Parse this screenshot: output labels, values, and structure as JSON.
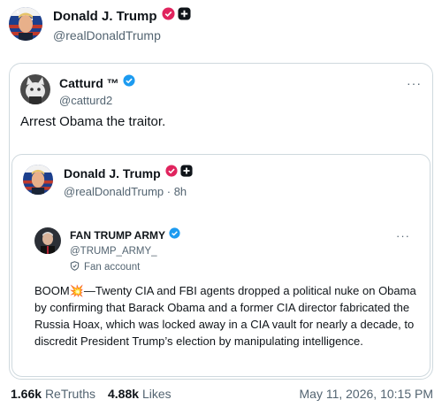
{
  "top_post": {
    "author_name": "Donald J. Trump",
    "author_handle": "@realDonaldTrump"
  },
  "quoted_post": {
    "author_name": "Catturd ™",
    "author_handle": "@catturd2",
    "text": "Arrest Obama the traitor.",
    "more_label": "···"
  },
  "inner_post": {
    "author_name": "Donald J. Trump",
    "author_handle": "@realDonaldTrump · 8h"
  },
  "fan_post": {
    "author_name": "FAN TRUMP ARMY",
    "author_handle": "@TRUMP_ARMY_",
    "account_label": "Fan account",
    "more_label": "···",
    "body_prefix": "BOOM",
    "body_emoji": "💥",
    "body_text": "—Twenty CIA and FBI agents dropped a political nuke on Obama by confirming that Barack Obama and a former CIA director fabricated the Russia Hoax, which was locked away in a CIA vault for nearly a decade, to discredit President Trump’s election by manipulating intelligence."
  },
  "footer": {
    "retruths_count": "1.66k",
    "retruths_label": "ReTruths",
    "likes_count": "4.88k",
    "likes_label": "Likes",
    "timestamp": "May 11, 2026, 10:15 PM"
  },
  "colors": {
    "verified_red": "#e0245e",
    "verified_blue": "#1d9bf0",
    "text_secondary": "#536471",
    "border": "#cfd9de"
  },
  "icons": {
    "verified_badge": "verified-badge-icon",
    "plus_badge": "plus-badge-icon",
    "fan_account": "shield-icon",
    "more": "more-icon"
  }
}
